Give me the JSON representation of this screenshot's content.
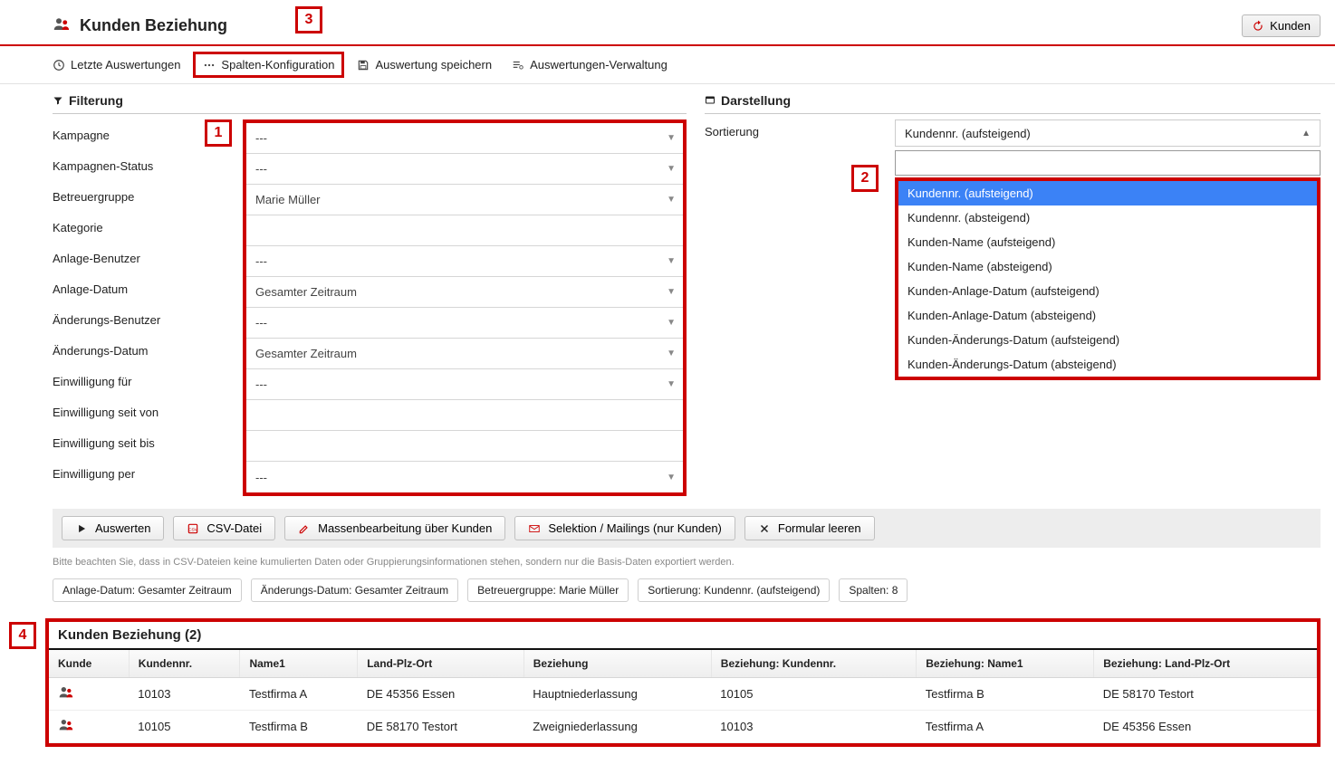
{
  "header": {
    "title": "Kunden Beziehung",
    "kunden_button": "Kunden"
  },
  "markers": {
    "m1": "1",
    "m2": "2",
    "m3": "3",
    "m4": "4"
  },
  "toolbar": {
    "last_eval": "Letzte Auswertungen",
    "col_config": "Spalten-Konfiguration",
    "save_eval": "Auswertung speichern",
    "eval_admin": "Auswertungen-Verwaltung"
  },
  "sections": {
    "filtering": "Filterung",
    "display": "Darstellung",
    "sort_label": "Sortierung"
  },
  "filters": [
    {
      "label": "Kampagne",
      "value": "---",
      "arrow": true
    },
    {
      "label": "Kampagnen-Status",
      "value": "---",
      "arrow": true
    },
    {
      "label": "Betreuergruppe",
      "value": "Marie Müller",
      "arrow": true
    },
    {
      "label": "Kategorie",
      "value": "",
      "arrow": false
    },
    {
      "label": "Anlage-Benutzer",
      "value": "---",
      "arrow": true
    },
    {
      "label": "Anlage-Datum",
      "value": "Gesamter Zeitraum",
      "arrow": true
    },
    {
      "label": "Änderungs-Benutzer",
      "value": "---",
      "arrow": true
    },
    {
      "label": "Änderungs-Datum",
      "value": "Gesamter Zeitraum",
      "arrow": true
    },
    {
      "label": "Einwilligung für",
      "value": "---",
      "arrow": true
    },
    {
      "label": "Einwilligung seit von",
      "value": "",
      "arrow": false
    },
    {
      "label": "Einwilligung seit bis",
      "value": "",
      "arrow": false
    },
    {
      "label": "Einwilligung per",
      "value": "---",
      "arrow": true
    }
  ],
  "sort": {
    "selected": "Kundennr. (aufsteigend)",
    "options": [
      "Kundennr. (aufsteigend)",
      "Kundennr. (absteigend)",
      "Kunden-Name (aufsteigend)",
      "Kunden-Name (absteigend)",
      "Kunden-Anlage-Datum (aufsteigend)",
      "Kunden-Anlage-Datum (absteigend)",
      "Kunden-Änderungs-Datum (aufsteigend)",
      "Kunden-Änderungs-Datum (absteigend)"
    ]
  },
  "actions": {
    "evaluate": "Auswerten",
    "csv": "CSV-Datei",
    "mass_edit": "Massenbearbeitung über Kunden",
    "selection": "Selektion / Mailings (nur Kunden)",
    "clear": "Formular leeren"
  },
  "note": "Bitte beachten Sie, dass in CSV-Dateien keine kumulierten Daten oder Gruppierungsinformationen stehen, sondern nur die Basis-Daten exportiert werden.",
  "chips": [
    "Anlage-Datum: Gesamter Zeitraum",
    "Änderungs-Datum: Gesamter Zeitraum",
    "Betreuergruppe: Marie Müller",
    "Sortierung: Kundennr. (aufsteigend)",
    "Spalten: 8"
  ],
  "results": {
    "title": "Kunden Beziehung (2)",
    "headers": [
      "Kunde",
      "Kundennr.",
      "Name1",
      "Land-Plz-Ort",
      "Beziehung",
      "Beziehung: Kundennr.",
      "Beziehung: Name1",
      "Beziehung: Land-Plz-Ort"
    ],
    "rows": [
      {
        "nr": "10103",
        "name": "Testfirma A",
        "ort": "DE 45356 Essen",
        "bez": "Hauptniederlassung",
        "bez_nr": "10105",
        "bez_name": "Testfirma B",
        "bez_ort": "DE 58170 Testort"
      },
      {
        "nr": "10105",
        "name": "Testfirma B",
        "ort": "DE 58170 Testort",
        "bez": "Zweigniederlassung",
        "bez_nr": "10103",
        "bez_name": "Testfirma A",
        "bez_ort": "DE 45356 Essen"
      }
    ]
  }
}
